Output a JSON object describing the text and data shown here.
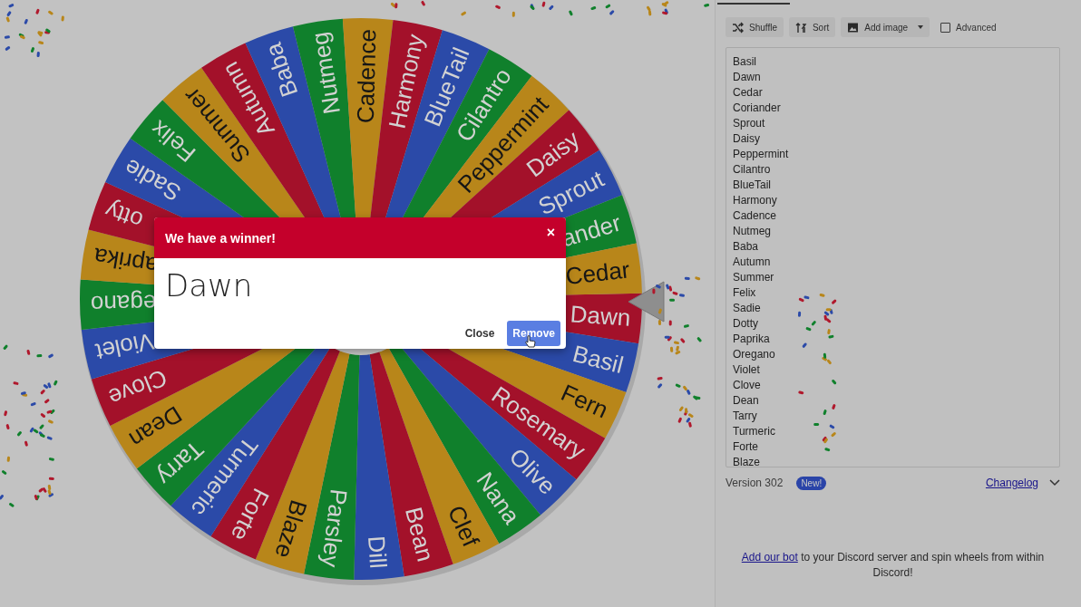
{
  "wheel": {
    "segments": [
      {
        "label": "Dawn",
        "color": "#a3112a"
      },
      {
        "label": "Basil",
        "color": "#2b4aa8"
      },
      {
        "label": "Fern",
        "color": "#b8861a"
      },
      {
        "label": "Rosemary",
        "color": "#a3112a"
      },
      {
        "label": "Olive",
        "color": "#2b4aa8"
      },
      {
        "label": "Nana",
        "color": "#10802c"
      },
      {
        "label": "Clef",
        "color": "#b8861a"
      },
      {
        "label": "Bean",
        "color": "#a3112a"
      },
      {
        "label": "Dill",
        "color": "#2b4aa8"
      },
      {
        "label": "Parsley",
        "color": "#10802c"
      },
      {
        "label": "Blaze",
        "color": "#b8861a"
      },
      {
        "label": "Forte",
        "color": "#a3112a"
      },
      {
        "label": "Turmeric",
        "color": "#2b4aa8"
      },
      {
        "label": "Tarry",
        "color": "#10802c"
      },
      {
        "label": "Dean",
        "color": "#b8861a"
      },
      {
        "label": "Clove",
        "color": "#a3112a"
      },
      {
        "label": "Violet",
        "color": "#2b4aa8"
      },
      {
        "label": "egano",
        "color": "#10802c"
      },
      {
        "label": "aprika",
        "color": "#b8861a"
      },
      {
        "label": "otty",
        "color": "#a3112a"
      },
      {
        "label": "Sadie",
        "color": "#2b4aa8"
      },
      {
        "label": "Felix",
        "color": "#10802c"
      },
      {
        "label": "Summer",
        "color": "#b8861a"
      },
      {
        "label": "Autumn",
        "color": "#a3112a"
      },
      {
        "label": "Baba",
        "color": "#2b4aa8"
      },
      {
        "label": "Nutmeg",
        "color": "#10802c"
      },
      {
        "label": "Cadence",
        "color": "#b8861a"
      },
      {
        "label": "Harmony",
        "color": "#a3112a"
      },
      {
        "label": "BlueTail",
        "color": "#2b4aa8"
      },
      {
        "label": "Cilantro",
        "color": "#10802c"
      },
      {
        "label": "Peppermint",
        "color": "#b8861a"
      },
      {
        "label": "Daisy",
        "color": "#a3112a"
      },
      {
        "label": "Sprout",
        "color": "#2b4aa8"
      },
      {
        "label": "ander",
        "color": "#10802c"
      },
      {
        "label": "Cedar",
        "color": "#b8861a"
      }
    ]
  },
  "dialog": {
    "title": "We have a winner!",
    "close": "×",
    "winner": "Dawn",
    "buttons": [
      {
        "label": "Close",
        "kind": "text"
      },
      {
        "label": "Remove",
        "kind": "primary"
      }
    ]
  },
  "sidebar": {
    "toolbar": {
      "buttons": [
        {
          "label": "Shuffle",
          "dropdown": false
        },
        {
          "label": "Sort",
          "dropdown": false
        },
        {
          "label": "Add image",
          "dropdown": true
        }
      ],
      "advanced": {
        "label": "Advanced",
        "checked": false
      }
    },
    "entries": [
      "Basil",
      "Dawn",
      "Cedar",
      "Coriander",
      "Sprout",
      "Daisy",
      "Peppermint",
      "Cilantro",
      "BlueTail",
      "Harmony",
      "Cadence",
      "Nutmeg",
      "Baba",
      "Autumn",
      "Summer",
      "Felix",
      "Sadie",
      "Dotty",
      "Paprika",
      "Oregano",
      "Violet",
      "Clove",
      "Dean",
      "Tarry",
      "Turmeric",
      "Forte",
      "Blaze"
    ],
    "version": "Version 302",
    "badge": "New!",
    "changelog": "Changelog",
    "discord_note": {
      "link": "Add our bot",
      "text": " to your Discord server and spin wheels from within Discord!"
    }
  }
}
